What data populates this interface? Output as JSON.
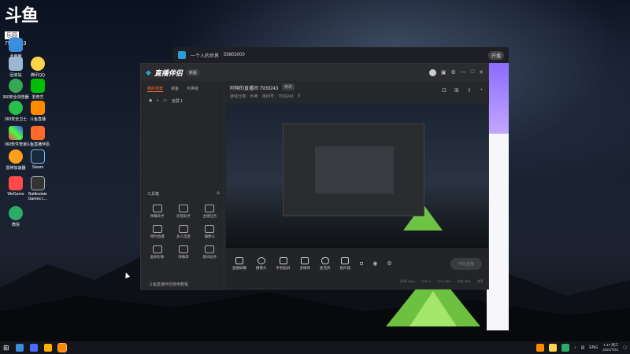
{
  "stream_logo": {
    "name": "斗鱼",
    "badge": "乐园",
    "room": "7939243"
  },
  "desktop": {
    "icons": [
      {
        "label": "此电脑"
      },
      {
        "label": "回收站"
      },
      {
        "label": "腾讯QQ"
      },
      {
        "label": "360安全浏览器"
      },
      {
        "label": "爱奇艺"
      },
      {
        "label": "360安全卫士"
      },
      {
        "label": "斗鱼直播"
      },
      {
        "label": "360软件管家"
      },
      {
        "label": "斗鱼直播伴侣"
      },
      {
        "label": "雷神加速器"
      },
      {
        "label": "Steam"
      },
      {
        "label": "WeGame"
      },
      {
        "label": "Battlestate Games L..."
      },
      {
        "label": "微信"
      }
    ]
  },
  "back_window": {
    "title": "一个人的世界",
    "count": "59803000",
    "badge": "开播"
  },
  "app": {
    "brand": "直播伴侣",
    "version_pill": "新版",
    "sidebar_tabs": [
      "我的场景",
      "装备",
      "可换装"
    ],
    "scene_label": "全屏 1",
    "tools_header": "工具箱",
    "tools": [
      {
        "label": "弹幕助手"
      },
      {
        "label": "房管助手"
      },
      {
        "label": "主播任务"
      },
      {
        "label": "预约直播"
      },
      {
        "label": "多人连麦"
      },
      {
        "label": "摄像头"
      },
      {
        "label": "虚拟形象"
      },
      {
        "label": "弹幕库"
      },
      {
        "label": "歌词助手"
      }
    ],
    "sidebar_footer": "斗鱼直播伴侣使用教程",
    "room_title": "阿翔的直播间 7939243",
    "edit_label": "修改",
    "room_sub": [
      "游戏分类：大神",
      "房间号：7939243",
      "0"
    ],
    "bottom_tools": [
      {
        "label": "直播屏幕"
      },
      {
        "label": "摄像头"
      },
      {
        "label": "手机投屏"
      },
      {
        "label": "多媒体"
      },
      {
        "label": "麦克风"
      },
      {
        "label": "扬声器"
      }
    ],
    "start_button": "开始直播",
    "status_items": [
      "码率 0kb/s",
      "FPS: 0",
      "CPU 49%",
      "内存 55%",
      "帧率"
    ]
  },
  "taskbar": {
    "lang": "ENG",
    "time": "1:17 周三",
    "date": "2021/7/21"
  },
  "colors": {
    "accent": "#ff6a2c",
    "window_bg": "#232427",
    "taskbar_bg": "#14161b"
  }
}
